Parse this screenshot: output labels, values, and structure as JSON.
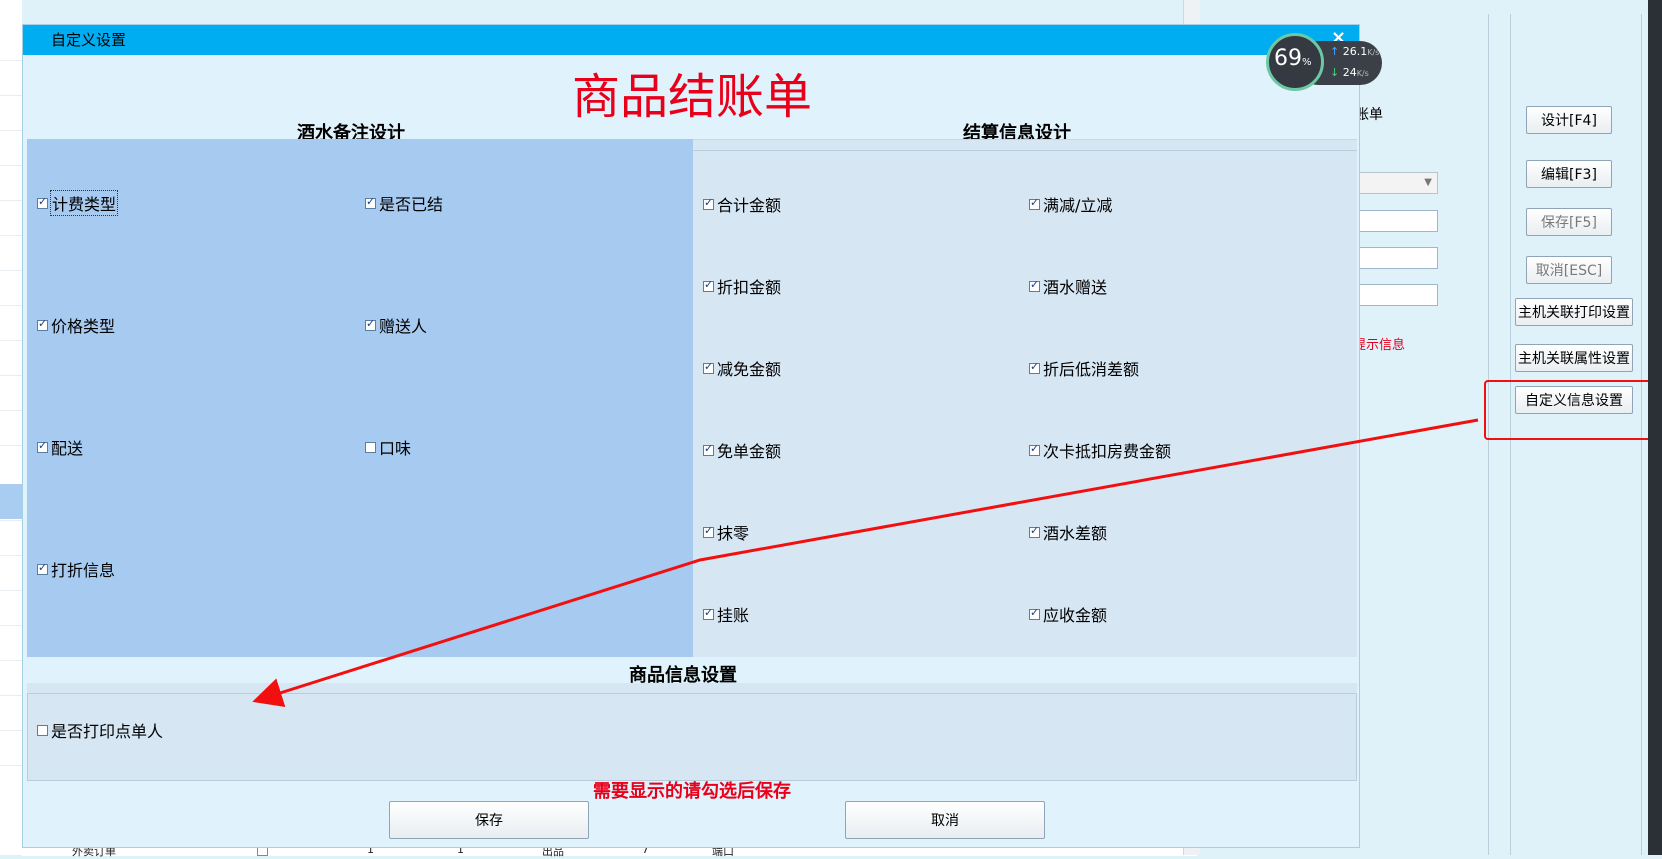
{
  "background": {
    "mid_panel": {
      "label_fragment": "账单",
      "select_value": "]",
      "red_fragment": "提示信息"
    },
    "side_buttons": [
      {
        "label": "设计[F4]",
        "enabled": true
      },
      {
        "label": "编辑[F3]",
        "enabled": true
      },
      {
        "label": "保存[F5]",
        "enabled": false
      },
      {
        "label": "取消[ESC]",
        "enabled": false
      },
      {
        "label": "主机关联打印设置",
        "enabled": true
      },
      {
        "label": "主机关联属性设置",
        "enabled": true
      },
      {
        "label": "自定义信息设置",
        "enabled": true
      }
    ],
    "table_row": {
      "name": "外卖订单",
      "col1": "1",
      "col2": "1",
      "col3": "出品",
      "col4": "7",
      "col5": "端口"
    }
  },
  "dialog": {
    "title": "自定义设置",
    "close_glyph": "×",
    "big_title": "商品结账单",
    "left_section": {
      "heading": "酒水备注设计",
      "items": [
        {
          "label": "计费类型",
          "checked": true
        },
        {
          "label": "是否已结",
          "checked": true
        },
        {
          "label": "价格类型",
          "checked": true
        },
        {
          "label": "赠送人",
          "checked": true
        },
        {
          "label": "配送",
          "checked": true
        },
        {
          "label": "口味",
          "checked": false
        },
        {
          "label": "打折信息",
          "checked": true
        }
      ]
    },
    "right_section": {
      "heading": "结算信息设计",
      "items": [
        {
          "label": "合计金额",
          "checked": true
        },
        {
          "label": "满减/立减",
          "checked": true
        },
        {
          "label": "折扣金额",
          "checked": true
        },
        {
          "label": "酒水赠送",
          "checked": true
        },
        {
          "label": "减免金额",
          "checked": true
        },
        {
          "label": "折后低消差额",
          "checked": true
        },
        {
          "label": "免单金额",
          "checked": true
        },
        {
          "label": "次卡抵扣房费金额",
          "checked": true
        },
        {
          "label": "抹零",
          "checked": true
        },
        {
          "label": "酒水差额",
          "checked": true
        },
        {
          "label": "挂账",
          "checked": true
        },
        {
          "label": "应收金额",
          "checked": true
        }
      ]
    },
    "bottom_section": {
      "heading": "商品信息设置",
      "items": [
        {
          "label": "是否打印点单人",
          "checked": false
        }
      ]
    },
    "note": "需要显示的请勾选后保存",
    "save_label": "保存",
    "cancel_label": "取消"
  },
  "speed_widget": {
    "percent": "69",
    "percent_unit": "%",
    "upload": "26.1",
    "download": "24",
    "unit": "K/s"
  },
  "colors": {
    "titlebar": "#00adf0",
    "accent_red": "#e8001a",
    "left_panel": "#a6caf0",
    "right_panel": "#d6e6f3"
  }
}
